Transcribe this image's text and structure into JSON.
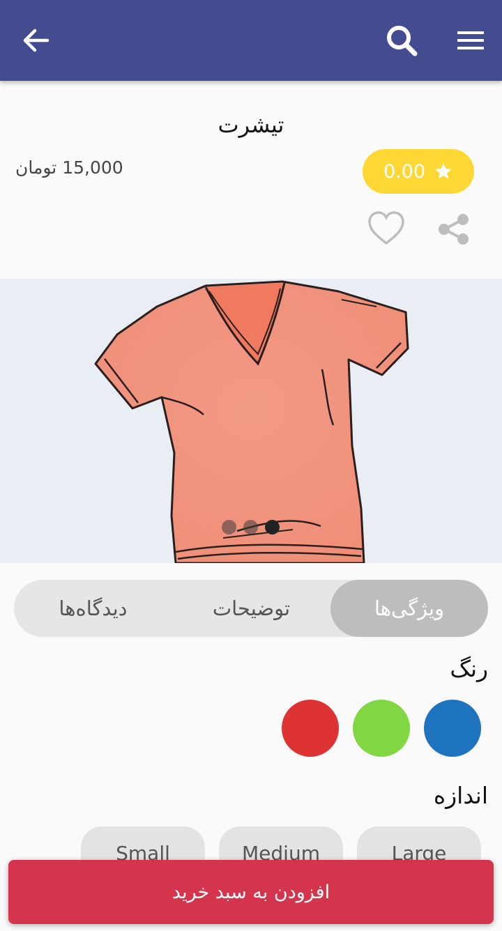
{
  "header": {
    "back_icon": "arrow-left-icon",
    "search_icon": "search-icon",
    "menu_icon": "hamburger-menu-icon",
    "background_color": "#434c8e"
  },
  "product": {
    "title": "تیشرت",
    "price": "15,000 تومان",
    "rating": "0.00",
    "rating_color": "#fdd835"
  },
  "gallery": {
    "image": "hand-drawn salmon v-neck t-shirt",
    "slide_count": 3,
    "active_slide": 3
  },
  "tabs": [
    {
      "label": "ویژگی‌ها",
      "active": true
    },
    {
      "label": "توضیحات",
      "active": false
    },
    {
      "label": "دیدگاه‌ها",
      "active": false
    }
  ],
  "attributes": {
    "color_label": "رنگ",
    "colors": [
      "#1e73be",
      "#81d742",
      "#dd3333"
    ],
    "size_label": "اندازه",
    "sizes": [
      "Large",
      "Medium",
      "Small"
    ]
  },
  "cart": {
    "add_label": "افزودن به سبد خرید",
    "button_color": "#d5344d"
  }
}
